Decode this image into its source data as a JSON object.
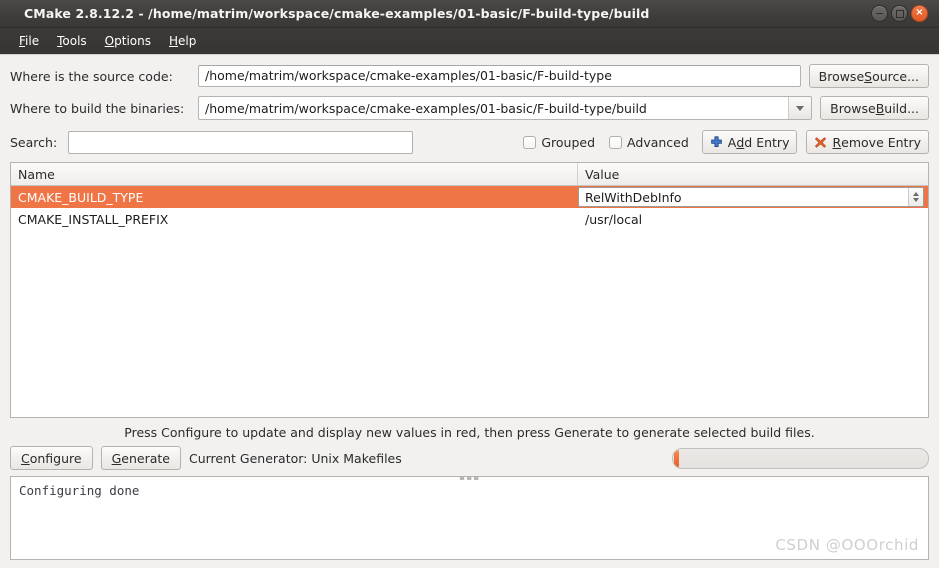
{
  "window": {
    "title": "CMake 2.8.12.2 - /home/matrim/workspace/cmake-examples/01-basic/F-build-type/build",
    "controls": {
      "minimize": "minimize-button",
      "maximize": "maximize-button",
      "close": "×"
    }
  },
  "menubar": {
    "items": [
      {
        "mnemonic": "F",
        "rest": "ile"
      },
      {
        "mnemonic": "T",
        "rest": "ools"
      },
      {
        "mnemonic": "O",
        "rest": "ptions"
      },
      {
        "mnemonic": "H",
        "rest": "elp"
      }
    ]
  },
  "paths": {
    "source_label": "Where is the source code:",
    "source_value": "/home/matrim/workspace/cmake-examples/01-basic/F-build-type",
    "browse_source": {
      "pre": "Browse ",
      "mnemonic": "S",
      "post": "ource..."
    },
    "binaries_label": "Where to build the binaries:",
    "binaries_value": "/home/matrim/workspace/cmake-examples/01-basic/F-build-type/build",
    "browse_build": {
      "pre": "Browse ",
      "mnemonic": "B",
      "post": "uild..."
    }
  },
  "search": {
    "label": "Search:",
    "value": "",
    "placeholder": ""
  },
  "filters": {
    "grouped_label": "Grouped",
    "grouped_checked": false,
    "advanced_label": "Advanced",
    "advanced_checked": false
  },
  "entry_buttons": {
    "add": {
      "pre": "A",
      "mnemonic": "d",
      "post": "d Entry"
    },
    "remove": {
      "pre": "",
      "mnemonic": "R",
      "post": "emove Entry"
    }
  },
  "cache_table": {
    "headers": [
      "Name",
      "Value"
    ],
    "rows": [
      {
        "name": "CMAKE_BUILD_TYPE",
        "value": "RelWithDebInfo",
        "selected": true,
        "editing": true
      },
      {
        "name": "CMAKE_INSTALL_PREFIX",
        "value": "/usr/local",
        "selected": false,
        "editing": false
      }
    ]
  },
  "hint": "Press Configure to update and display new values in red, then press Generate to generate selected build files.",
  "actions": {
    "configure": {
      "mnemonic": "C",
      "rest": "onfigure"
    },
    "generate": {
      "mnemonic": "G",
      "rest": "enerate"
    },
    "generator_text": "Current Generator: Unix Makefiles",
    "progress_percent": 2
  },
  "output": {
    "log": "Configuring done"
  },
  "watermark": "CSDN @OOOrchid",
  "colors": {
    "accent_orange": "#ef7546",
    "titlebar": "#403e3c",
    "menubar": "#3a3836",
    "window_bg": "#f2f1f0",
    "close_button": "#e9602a",
    "add_icon_blue": "#2d5ea8",
    "remove_icon_orange": "#e2622a"
  }
}
